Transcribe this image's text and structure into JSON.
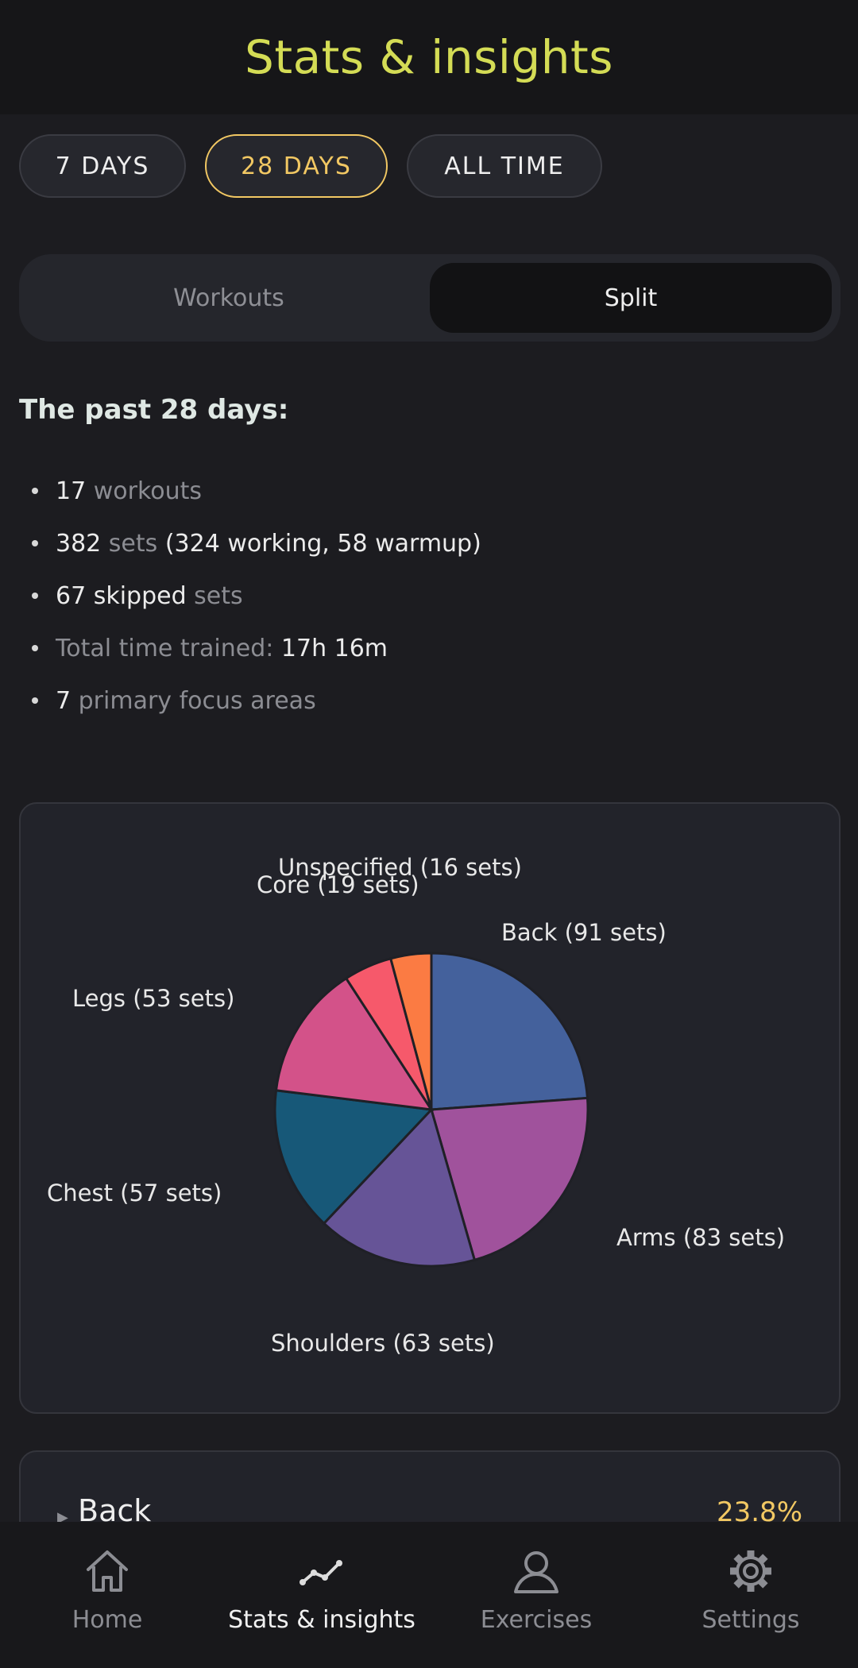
{
  "header": {
    "title": "Stats & insights"
  },
  "ranges": [
    {
      "label": "7 DAYS",
      "selected": false
    },
    {
      "label": "28 DAYS",
      "selected": true
    },
    {
      "label": "ALL TIME",
      "selected": false
    }
  ],
  "view_tabs": [
    {
      "label": "Workouts",
      "selected": false
    },
    {
      "label": "Split",
      "selected": true
    }
  ],
  "summary": {
    "title": "The past 28 days:",
    "items": [
      {
        "value": "17",
        "text": " workouts",
        "extra": ""
      },
      {
        "value": "382",
        "text": " sets",
        "extra": " (324 working, 58 warmup)"
      },
      {
        "value": "67 skipped",
        "text": " sets",
        "extra": ""
      },
      {
        "value": "",
        "text": "Total time trained: ",
        "extra": "17h 16m"
      },
      {
        "value": "7",
        "text": " primary focus areas",
        "extra": ""
      }
    ]
  },
  "chart_data": {
    "type": "pie",
    "title": "",
    "slices": [
      {
        "name": "Back",
        "label": "Back (91 sets)",
        "value": 91,
        "color": "#44619c"
      },
      {
        "name": "Arms",
        "label": "Arms (83 sets)",
        "value": 83,
        "color": "#a0529c"
      },
      {
        "name": "Shoulders",
        "label": "Shoulders (63 sets)",
        "value": 63,
        "color": "#665497"
      },
      {
        "name": "Chest",
        "label": "Chest (57 sets)",
        "value": 57,
        "color": "#175878"
      },
      {
        "name": "Legs",
        "label": "Legs (53 sets)",
        "value": 53,
        "color": "#d35289"
      },
      {
        "name": "Core",
        "label": "Core (19 sets)",
        "value": 19,
        "color": "#f6596b"
      },
      {
        "name": "Unspecified",
        "label": "Unspecified (16 sets)",
        "value": 16,
        "color": "#fb7b43"
      }
    ]
  },
  "breakdown": [
    {
      "name": "Back",
      "percent": "23.8%"
    }
  ],
  "bottom_nav": [
    {
      "label": "Home",
      "icon": "home-icon",
      "active": false
    },
    {
      "label": "Stats & insights",
      "icon": "trend-icon",
      "active": true
    },
    {
      "label": "Exercises",
      "icon": "person-icon",
      "active": false
    },
    {
      "label": "Settings",
      "icon": "gear-icon",
      "active": false
    }
  ],
  "colors": {
    "accent": "#d4dc55",
    "selected": "#f2c863",
    "background": "#1c1c20"
  }
}
